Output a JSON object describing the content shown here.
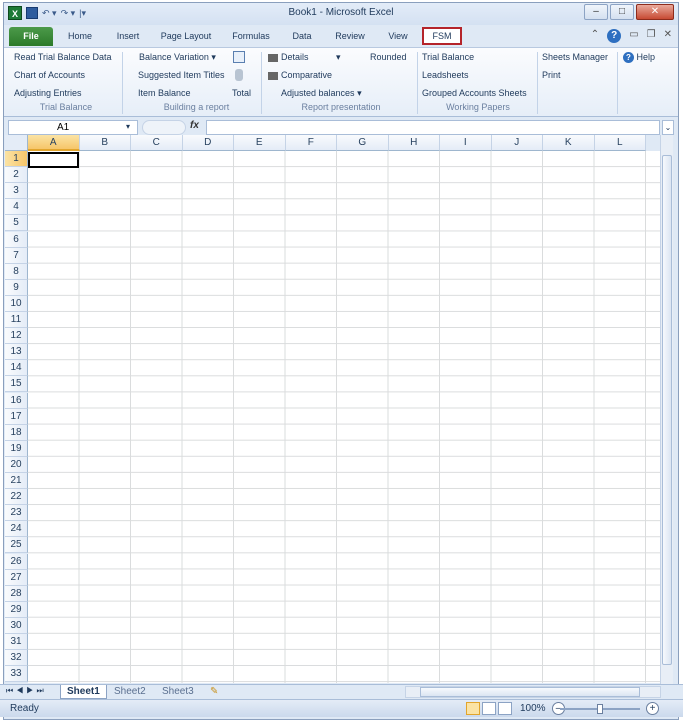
{
  "titlebar": {
    "title": "Book1 - Microsoft Excel",
    "app_icon": "X"
  },
  "tabs": [
    "File",
    "Home",
    "Insert",
    "Page Layout",
    "Formulas",
    "Data",
    "Review",
    "View",
    "FSM"
  ],
  "ribbon": {
    "trial_balance": {
      "items": [
        "Read Trial Balance Data",
        "Chart of Accounts",
        "Adjusting Entries"
      ],
      "label": "Trial Balance"
    },
    "building": {
      "items": [
        "Balance Variation",
        "Suggested Item Titles",
        "Item Balance",
        "Total"
      ],
      "label": "Building a report"
    },
    "presentation": {
      "items": [
        "Details",
        "Comparative",
        "Adjusted balances",
        "Rounded"
      ],
      "label": "Report presentation"
    },
    "papers": {
      "items": [
        "Trial Balance",
        "Leadsheets",
        "Grouped Accounts Sheets"
      ],
      "label": "Working Papers"
    },
    "misc": {
      "items": [
        "Sheets Manager",
        "Print",
        "Help"
      ]
    }
  },
  "formula_bar": {
    "namebox": "A1",
    "fx": "fx",
    "expand": "⌄"
  },
  "columns": [
    "A",
    "B",
    "C",
    "D",
    "E",
    "F",
    "G",
    "H",
    "I",
    "J",
    "K",
    "L"
  ],
  "rows": [
    "1",
    "2",
    "3",
    "4",
    "5",
    "6",
    "7",
    "8",
    "9",
    "10",
    "11",
    "12",
    "13",
    "14",
    "15",
    "16",
    "17",
    "18",
    "19",
    "20",
    "21",
    "22",
    "23",
    "24",
    "25",
    "26",
    "27",
    "28",
    "29",
    "30",
    "31",
    "32",
    "33"
  ],
  "sheets": [
    "Sheet1",
    "Sheet2",
    "Sheet3"
  ],
  "status": {
    "ready": "Ready",
    "zoom": "100%"
  },
  "colors": {
    "file_tab": "#2c7a2a",
    "fsm_highlight": "#b5242a",
    "selected_header": "#f6c66a"
  }
}
